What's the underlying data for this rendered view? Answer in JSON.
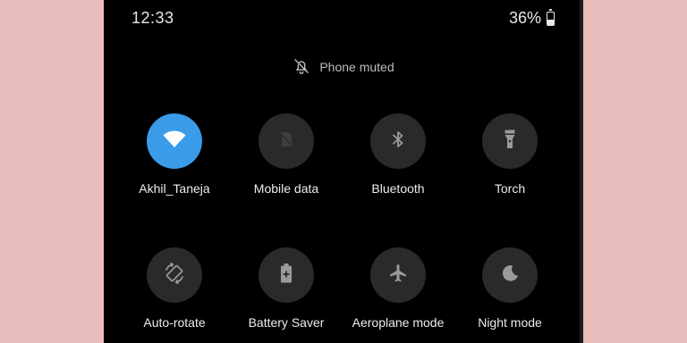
{
  "status_bar": {
    "time": "12:33",
    "battery_percent": "36%",
    "battery_level": 0.36
  },
  "notice": {
    "icon": "bell-off-icon",
    "text": "Phone muted"
  },
  "colors": {
    "accent": "#3a9be8",
    "tile_inactive": "#2a2a2a",
    "background_outer": "#e9bdbb"
  },
  "tiles": [
    {
      "label": "Akhil_Taneja",
      "icon": "wifi-icon",
      "active": true
    },
    {
      "label": "Mobile data",
      "icon": "mobile-data-off-icon",
      "active": false
    },
    {
      "label": "Bluetooth",
      "icon": "bluetooth-icon",
      "active": false
    },
    {
      "label": "Torch",
      "icon": "torch-icon",
      "active": false
    },
    {
      "label": "Auto-rotate",
      "icon": "auto-rotate-icon",
      "active": false
    },
    {
      "label": "Battery Saver",
      "icon": "battery-saver-icon",
      "active": false
    },
    {
      "label": "Aeroplane mode",
      "icon": "airplane-icon",
      "active": false
    },
    {
      "label": "Night mode",
      "icon": "moon-icon",
      "active": false
    }
  ]
}
